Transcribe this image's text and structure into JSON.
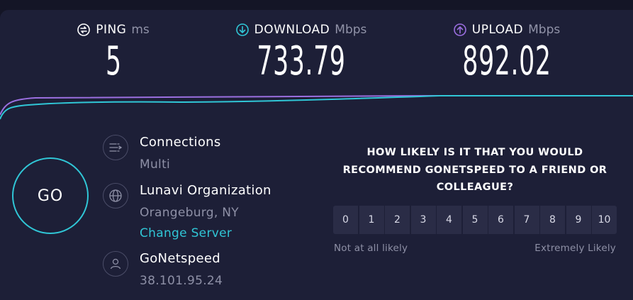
{
  "metrics": {
    "ping": {
      "label": "PING",
      "unit": "ms",
      "value": "5"
    },
    "download": {
      "label": "DOWNLOAD",
      "unit": "Mbps",
      "value": "733.79"
    },
    "upload": {
      "label": "UPLOAD",
      "unit": "Mbps",
      "value": "892.02"
    }
  },
  "go_button": {
    "label": "GO"
  },
  "connections": {
    "title": "Connections",
    "value": "Multi"
  },
  "server": {
    "name": "Lunavi Organization",
    "location": "Orangeburg, NY",
    "change_link": "Change Server"
  },
  "isp": {
    "name": "GoNetspeed",
    "ip": "38.101.95.24"
  },
  "survey": {
    "question": "HOW LIKELY IS IT THAT YOU WOULD RECOMMEND GONETSPEED TO A FRIEND OR COLLEAGUE?",
    "scale": [
      "0",
      "1",
      "2",
      "3",
      "4",
      "5",
      "6",
      "7",
      "8",
      "9",
      "10"
    ],
    "low_label": "Not at all likely",
    "high_label": "Extremely Likely"
  },
  "colors": {
    "background": "#1d1f37",
    "accent_download": "#30c6d6",
    "accent_upload": "#9b6fe0"
  }
}
